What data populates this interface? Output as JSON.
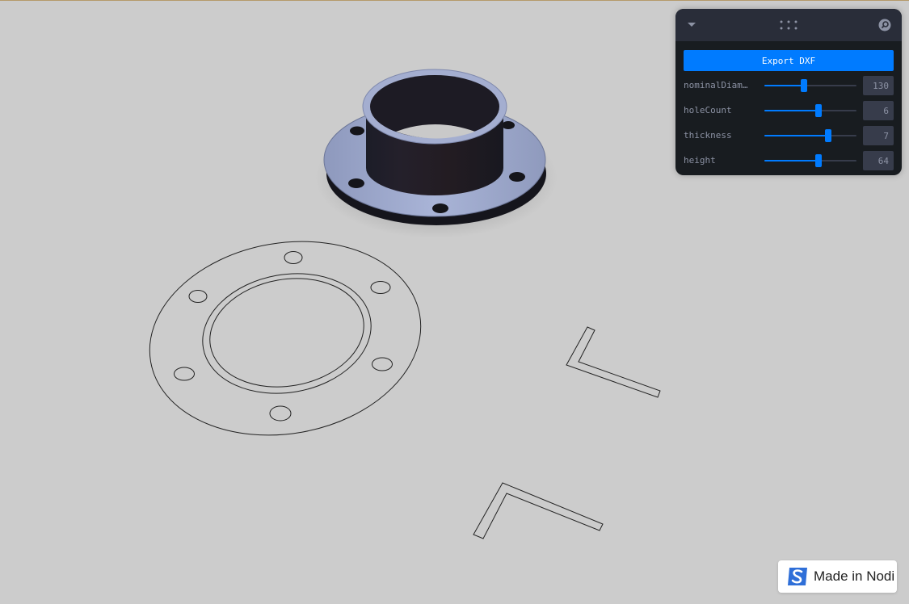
{
  "panel": {
    "export_label": "Export DXF",
    "params": [
      {
        "label": "nominalDiam…",
        "value": "130",
        "fraction": 0.43
      },
      {
        "label": "holeCount",
        "value": "6",
        "fraction": 0.59
      },
      {
        "label": "thickness",
        "value": "7",
        "fraction": 0.69
      },
      {
        "label": "height",
        "value": "64",
        "fraction": 0.59
      }
    ]
  },
  "badge": {
    "text": "Made in Nodi"
  },
  "icons": {
    "collapse": "chevron-down-icon",
    "drag": "drag-handle-icon",
    "search": "search-icon",
    "brand": "nodi-logo-icon"
  },
  "colors": {
    "accent": "#007bff",
    "background": "#cccccc",
    "panel": "#181c20"
  }
}
